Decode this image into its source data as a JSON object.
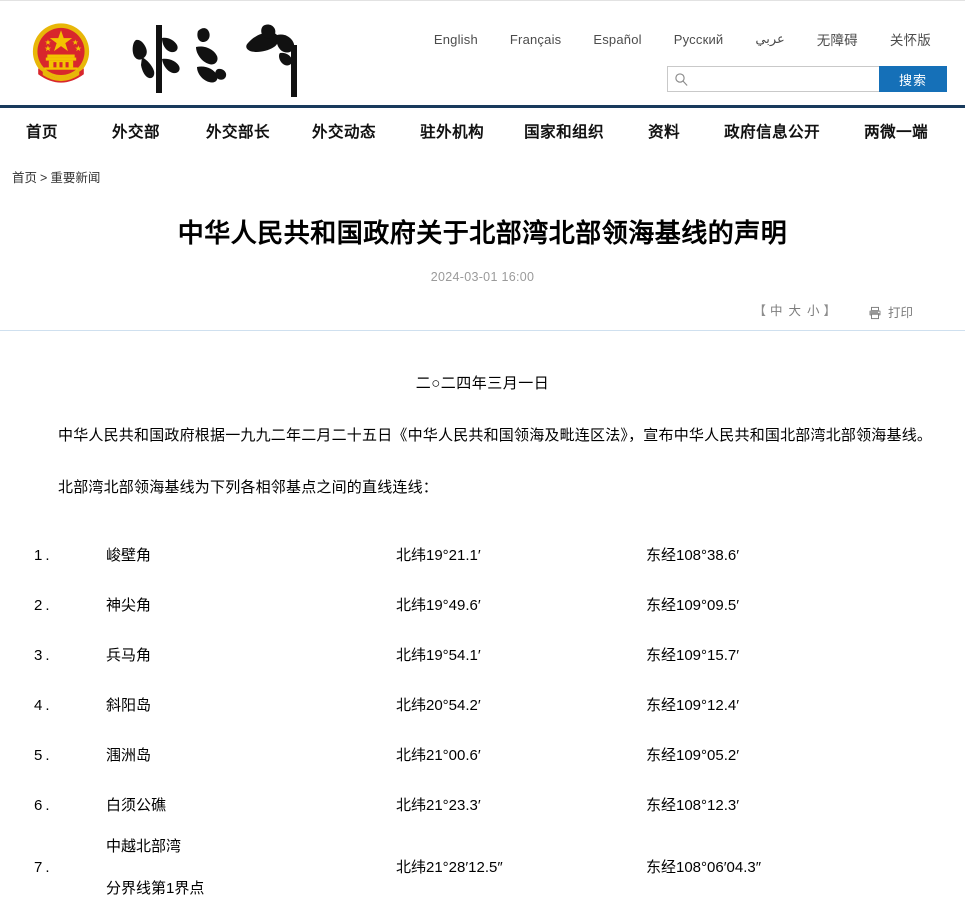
{
  "site": {
    "emblem_alt": "national-emblem",
    "logo_text": "外交部",
    "languages": [
      {
        "label": "English"
      },
      {
        "label": "Français"
      },
      {
        "label": "Español"
      },
      {
        "label": "Русский"
      },
      {
        "label": "عربي"
      },
      {
        "label": "无障碍"
      },
      {
        "label": "关怀版"
      }
    ],
    "search": {
      "placeholder": "",
      "value": "",
      "button_label": "搜索",
      "icon": "search-icon"
    },
    "nav": [
      {
        "label": "首页"
      },
      {
        "label": "外交部"
      },
      {
        "label": "外交部长"
      },
      {
        "label": "外交动态"
      },
      {
        "label": "驻外机构"
      },
      {
        "label": "国家和组织"
      },
      {
        "label": "资料"
      },
      {
        "label": "政府信息公开"
      },
      {
        "label": "两微一端"
      }
    ]
  },
  "breadcrumb": {
    "home": "首页",
    "separator": ">",
    "current": "重要新闻"
  },
  "article": {
    "title": "中华人民共和国政府关于北部湾北部领海基线的声明",
    "datetime": "2024-03-01 16:00",
    "tools": {
      "bracket_open": "【",
      "bracket_close": "】",
      "size_medium": "中",
      "size_large": "大",
      "size_small": "小",
      "print_label": "打印",
      "print_icon": "printer-icon"
    },
    "date_line": "二○二四年三月一日",
    "paragraphs": [
      "中华人民共和国政府根据一九九二年二月二十五日《中华人民共和国领海及毗连区法》，宣布中华人民共和国北部湾北部领海基线。",
      "北部湾北部领海基线为下列各相邻基点之间的直线连线："
    ],
    "points": [
      {
        "num": "1.",
        "name_line1": "峻壁角",
        "name_line2": "",
        "lat": "北纬19°21.1′",
        "lon": "东经108°38.6′"
      },
      {
        "num": "2.",
        "name_line1": "神尖角",
        "name_line2": "",
        "lat": "北纬19°49.6′",
        "lon": "东经109°09.5′"
      },
      {
        "num": "3.",
        "name_line1": "兵马角",
        "name_line2": "",
        "lat": "北纬19°54.1′",
        "lon": "东经109°15.7′"
      },
      {
        "num": "4.",
        "name_line1": "斜阳岛",
        "name_line2": "",
        "lat": "北纬20°54.2′",
        "lon": "东经109°12.4′"
      },
      {
        "num": "5.",
        "name_line1": "涠洲岛",
        "name_line2": "",
        "lat": "北纬21°00.6′",
        "lon": "东经109°05.2′"
      },
      {
        "num": "6.",
        "name_line1": "白须公礁",
        "name_line2": "",
        "lat": "北纬21°23.3′",
        "lon": "东经108°12.3′"
      },
      {
        "num": "7.",
        "name_line1": "中越北部湾",
        "name_line2": "分界线第1界点",
        "lat": "北纬21°28′12.5″",
        "lon": "东经108°06′04.3″"
      }
    ]
  },
  "colors": {
    "accent_blue": "#1570b8",
    "nav_border": "#183a5c",
    "divider": "#cfe0ef",
    "emblem_gold": "#f5c518",
    "emblem_red": "#e60012"
  }
}
